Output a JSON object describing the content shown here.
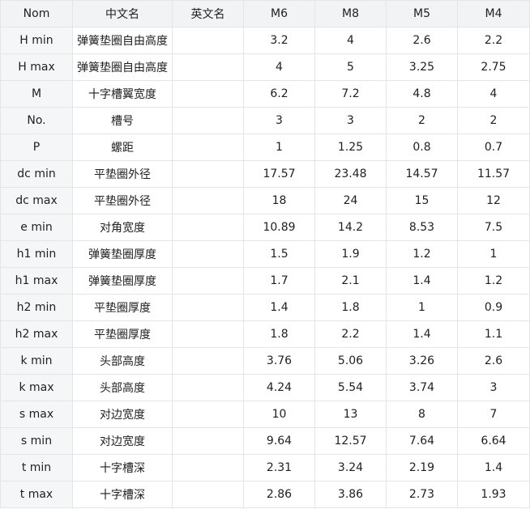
{
  "table": {
    "headers": [
      "Nom",
      "中文名",
      "英文名",
      "M6",
      "M8",
      "M5",
      "M4"
    ],
    "rows": [
      {
        "nom": "H min",
        "cn": "弹簧垫圈自由高度",
        "en": "",
        "values": [
          "3.2",
          "4",
          "2.6",
          "2.2"
        ]
      },
      {
        "nom": "H max",
        "cn": "弹簧垫圈自由高度",
        "en": "",
        "values": [
          "4",
          "5",
          "3.25",
          "2.75"
        ]
      },
      {
        "nom": "M",
        "cn": "十字槽翼宽度",
        "en": "",
        "values": [
          "6.2",
          "7.2",
          "4.8",
          "4"
        ]
      },
      {
        "nom": "No.",
        "cn": "槽号",
        "en": "",
        "values": [
          "3",
          "3",
          "2",
          "2"
        ]
      },
      {
        "nom": "P",
        "cn": "螺距",
        "en": "",
        "values": [
          "1",
          "1.25",
          "0.8",
          "0.7"
        ]
      },
      {
        "nom": "dc min",
        "cn": "平垫圈外径",
        "en": "",
        "values": [
          "17.57",
          "23.48",
          "14.57",
          "11.57"
        ]
      },
      {
        "nom": "dc max",
        "cn": "平垫圈外径",
        "en": "",
        "values": [
          "18",
          "24",
          "15",
          "12"
        ]
      },
      {
        "nom": "e min",
        "cn": "对角宽度",
        "en": "",
        "values": [
          "10.89",
          "14.2",
          "8.53",
          "7.5"
        ]
      },
      {
        "nom": "h1 min",
        "cn": "弹簧垫圈厚度",
        "en": "",
        "values": [
          "1.5",
          "1.9",
          "1.2",
          "1"
        ]
      },
      {
        "nom": "h1 max",
        "cn": "弹簧垫圈厚度",
        "en": "",
        "values": [
          "1.7",
          "2.1",
          "1.4",
          "1.2"
        ]
      },
      {
        "nom": "h2 min",
        "cn": "平垫圈厚度",
        "en": "",
        "values": [
          "1.4",
          "1.8",
          "1",
          "0.9"
        ]
      },
      {
        "nom": "h2 max",
        "cn": "平垫圈厚度",
        "en": "",
        "values": [
          "1.8",
          "2.2",
          "1.4",
          "1.1"
        ]
      },
      {
        "nom": "k min",
        "cn": "头部高度",
        "en": "",
        "values": [
          "3.76",
          "5.06",
          "3.26",
          "2.6"
        ]
      },
      {
        "nom": "k max",
        "cn": "头部高度",
        "en": "",
        "values": [
          "4.24",
          "5.54",
          "3.74",
          "3"
        ]
      },
      {
        "nom": "s max",
        "cn": "对边宽度",
        "en": "",
        "values": [
          "10",
          "13",
          "8",
          "7"
        ]
      },
      {
        "nom": "s min",
        "cn": "对边宽度",
        "en": "",
        "values": [
          "9.64",
          "12.57",
          "7.64",
          "6.64"
        ]
      },
      {
        "nom": "t min",
        "cn": "十字槽深",
        "en": "",
        "values": [
          "2.31",
          "3.24",
          "2.19",
          "1.4"
        ]
      },
      {
        "nom": "t max",
        "cn": "十字槽深",
        "en": "",
        "values": [
          "2.86",
          "3.86",
          "2.73",
          "1.93"
        ]
      }
    ]
  },
  "colors": {
    "header_bg": "#f2f3f5",
    "first_col_bg": "#f5f6f8",
    "border": "#e3e5e8",
    "text": "#1f1f1f"
  }
}
